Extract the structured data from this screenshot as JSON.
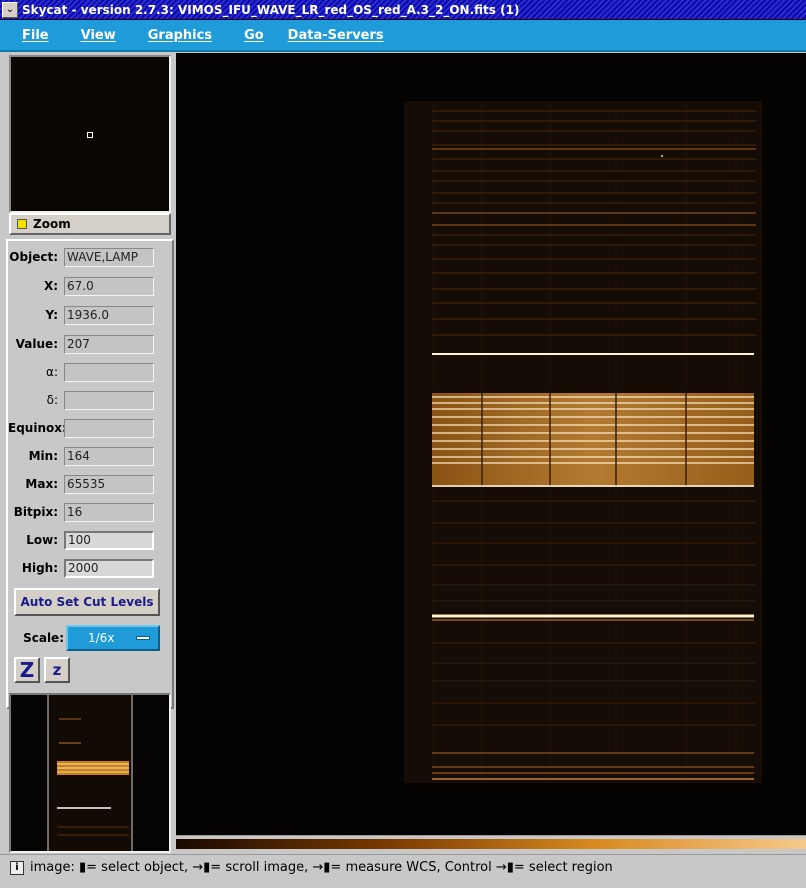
{
  "window": {
    "title": "Skycat - version 2.7.3: VIMOS_IFU_WAVE_LR_red_OS_red_A.3_2_ON.fits (1)",
    "button_icon": "chevron-down-icon"
  },
  "menu": {
    "items": [
      "File",
      "View",
      "Graphics",
      "Go",
      "Data-Servers"
    ]
  },
  "panner": {
    "zoom_label": "Zoom"
  },
  "info": {
    "object": {
      "label": "Object:",
      "value": "WAVE,LAMP"
    },
    "x": {
      "label": "X:",
      "value": "67.0"
    },
    "y": {
      "label": "Y:",
      "value": "1936.0"
    },
    "value": {
      "label": "Value:",
      "value": "207"
    },
    "alpha": {
      "label": "α:",
      "value": ""
    },
    "delta": {
      "label": "δ:",
      "value": ""
    },
    "equinox": {
      "label": "Equinox:",
      "value": ""
    },
    "min": {
      "label": "Min:",
      "value": "164"
    },
    "max": {
      "label": "Max:",
      "value": "65535"
    },
    "bitpix": {
      "label": "Bitpix:",
      "value": "16"
    },
    "low": {
      "label": "Low:",
      "value": "100"
    },
    "high": {
      "label": "High:",
      "value": "2000"
    }
  },
  "controls": {
    "auto_cut_label": "Auto Set Cut Levels",
    "scale_label": "Scale:",
    "scale_value": "1/6x",
    "zoom_in_label": "Z",
    "zoom_out_label": "z"
  },
  "status": {
    "icon": "info-icon",
    "text": "image: ▮= select object, →▮= scroll image, →▮= measure WCS, Control →▮= select region"
  },
  "colors": {
    "menu_bg": "#1e9bd8",
    "title_bg": "#1a1aa8",
    "image_bg": "#050302",
    "spectrum_line": "#f0a040"
  }
}
